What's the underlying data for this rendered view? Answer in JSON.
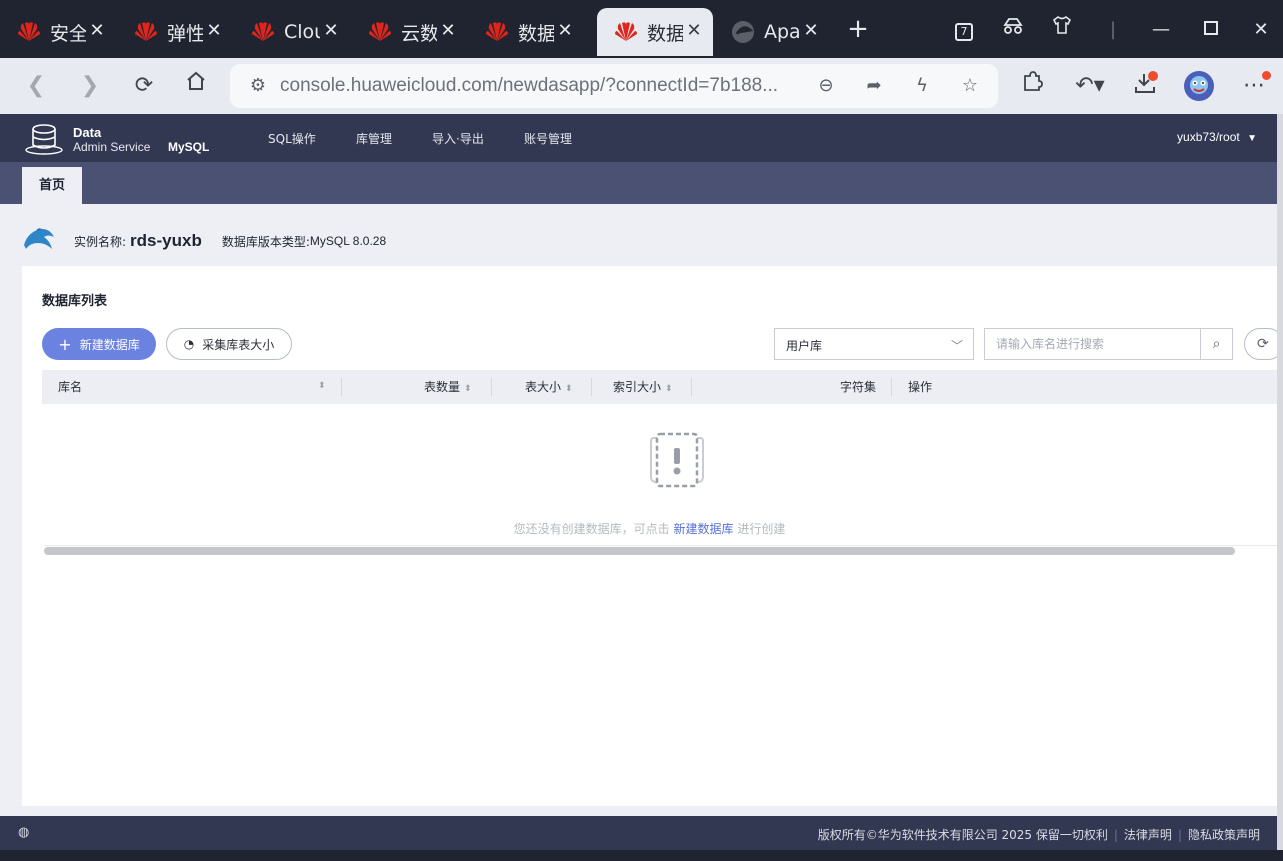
{
  "browser": {
    "tabs": [
      {
        "title": "安全"
      },
      {
        "title": "弹性"
      },
      {
        "title": "Clou"
      },
      {
        "title": "云数"
      },
      {
        "title": "数据"
      },
      {
        "title": "数据",
        "active": true
      },
      {
        "title": "Apa"
      }
    ],
    "tab_counter": "7",
    "address": "console.huaweicloud.com/newdasapp/?connectId=7b188..."
  },
  "app": {
    "logo_line1": "Data",
    "logo_line2": "Admin Service",
    "logo_engine": "MySQL",
    "nav": [
      "SQL操作",
      "库管理",
      "导入·导出",
      "账号管理"
    ],
    "user": "yuxb73/root",
    "home_tab": "首页"
  },
  "instance": {
    "name_label": "实例名称:",
    "name": "rds-yuxb",
    "version_label": "数据库版本类型:",
    "version": "MySQL 8.0.28"
  },
  "db_list": {
    "title": "数据库列表",
    "create_button": "新建数据库",
    "collect_button": "采集库表大小",
    "filter_value": "用户库",
    "search_placeholder": "请输入库名进行搜索",
    "columns": [
      "库名",
      "表数量",
      "表大小",
      "索引大小",
      "字符集",
      "操作"
    ],
    "empty_text_prefix": "您还没有创建数据库，可点击 ",
    "empty_text_link": "新建数据库",
    "empty_text_suffix": " 进行创建"
  },
  "footer": {
    "copyright": "版权所有©华为软件技术有限公司 2025 保留一切权利",
    "legal": "法律声明",
    "privacy": "隐私政策声明"
  },
  "colors": {
    "header_bg": "#323852",
    "tabrow_bg": "#4a5172",
    "primary": "#6b82e0",
    "link": "#5670d6"
  }
}
